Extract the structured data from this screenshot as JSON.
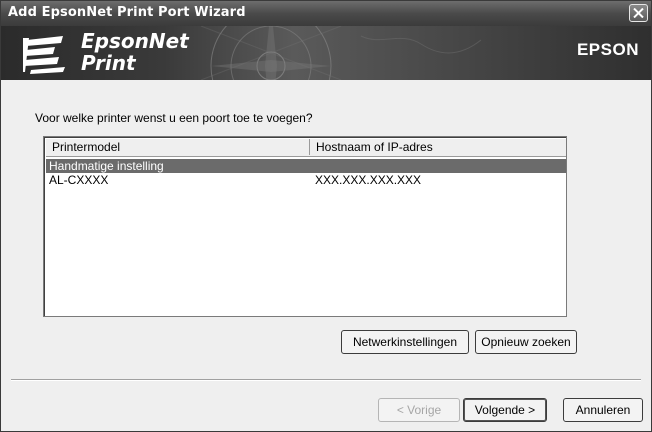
{
  "window": {
    "title": "Add EpsonNet Print Port Wizard"
  },
  "banner": {
    "product_line1": "EpsonNet",
    "product_line2": "Print",
    "brand": "EPSON"
  },
  "main": {
    "question": "Voor welke printer wenst u een poort toe te voegen?",
    "list": {
      "columns": [
        "Printermodel",
        "Hostnaam of IP-adres"
      ],
      "rows": [
        {
          "model": "Handmatige instelling",
          "host": "",
          "selected": true
        },
        {
          "model": "AL-CXXXX",
          "host": "XXX.XXX.XXX.XXX",
          "selected": false
        }
      ]
    },
    "buttons": {
      "network_settings": "Netwerkinstellingen",
      "search_again": "Opnieuw zoeken"
    }
  },
  "footer": {
    "back": "< Vorige",
    "next": "Volgende >",
    "cancel": "Annuleren"
  },
  "icons": {
    "close": "close-icon",
    "logo": "epsonnet-logo-icon"
  },
  "colors": {
    "titlebar": "#4a4a4a",
    "selection": "#6b6b6b",
    "dialog_bg": "#efefef"
  }
}
